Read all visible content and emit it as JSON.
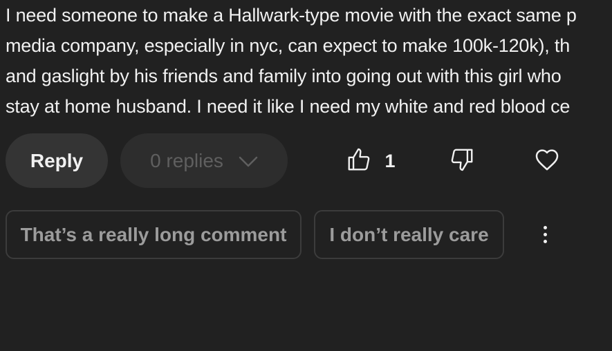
{
  "comment": {
    "lines": [
      "I need someone to make a Hallwark-type movie with the exact same p",
      "media company, especially in nyc, can expect to make 100k-120k), th",
      "and gaslight by his friends and family into going out with this girl who",
      "stay at home husband. I need it like I need my white and red blood ce"
    ]
  },
  "actions": {
    "reply_label": "Reply",
    "replies_label": "0 replies",
    "like_count": "1",
    "icons": {
      "replies": "chevron-down-icon",
      "like": "thumbs-up-icon",
      "dislike": "thumbs-down-icon",
      "heart": "heart-icon",
      "more": "more-vert-icon"
    }
  },
  "suggestions": [
    "That’s a really long comment",
    "I don’t really care"
  ],
  "colors": {
    "background": "#212121",
    "text": "#f1f1f1",
    "muted_text": "#5f5f5f",
    "chip_text": "#9c9c9c",
    "reply_bg": "#343434",
    "replies_bg": "#2d2d2d",
    "chip_border": "#3c3c3c"
  }
}
